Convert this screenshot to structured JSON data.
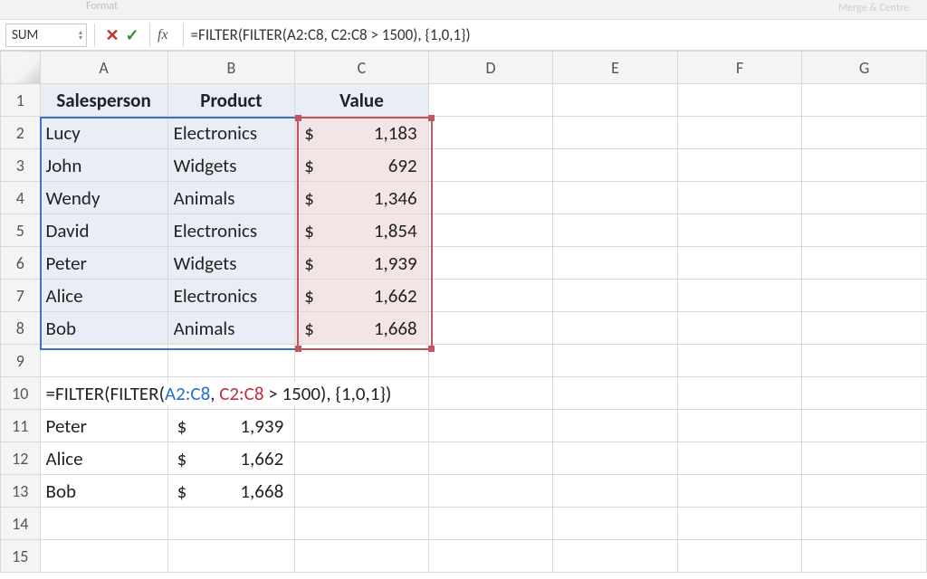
{
  "ribbon": {
    "format_hint": "Format",
    "faded_right": "Merge & Centre"
  },
  "formula_bar": {
    "name_box": "SUM",
    "cancel_glyph": "✕",
    "accept_glyph": "✓",
    "fx_label": "fx",
    "formula": "=FILTER(FILTER(A2:C8, C2:C8 > 1500), {1,0,1})"
  },
  "columns": [
    "A",
    "B",
    "C",
    "D",
    "E",
    "F",
    "G"
  ],
  "rows": [
    "1",
    "2",
    "3",
    "4",
    "5",
    "6",
    "7",
    "8",
    "9",
    "10",
    "11",
    "12",
    "13",
    "14",
    "15"
  ],
  "headers": {
    "salesperson": "Salesperson",
    "product": "Product",
    "value": "Value"
  },
  "data": [
    {
      "salesperson": "Lucy",
      "product": "Electronics",
      "value": "1,183"
    },
    {
      "salesperson": "John",
      "product": "Widgets",
      "value": "692"
    },
    {
      "salesperson": "Wendy",
      "product": "Animals",
      "value": "1,346"
    },
    {
      "salesperson": "David",
      "product": "Electronics",
      "value": "1,854"
    },
    {
      "salesperson": "Peter",
      "product": "Widgets",
      "value": "1,939"
    },
    {
      "salesperson": "Alice",
      "product": "Electronics",
      "value": "1,662"
    },
    {
      "salesperson": "Bob",
      "product": "Animals",
      "value": "1,668"
    }
  ],
  "currency_symbol": "$",
  "row10_formula": {
    "pre": "=FILTER(FILTER(",
    "r1": "A2:C8",
    "mid1": ", ",
    "r2": "C2:C8",
    "mid2": " > 1500), {1,0,1})"
  },
  "filtered": [
    {
      "name": "Peter",
      "value": "1,939"
    },
    {
      "name": "Alice",
      "value": "1,662"
    },
    {
      "name": "Bob",
      "value": "1,668"
    }
  ],
  "chart_data": {
    "type": "table",
    "columns": [
      "Salesperson",
      "Product",
      "Value"
    ],
    "rows": [
      [
        "Lucy",
        "Electronics",
        1183
      ],
      [
        "John",
        "Widgets",
        692
      ],
      [
        "Wendy",
        "Animals",
        1346
      ],
      [
        "David",
        "Electronics",
        1854
      ],
      [
        "Peter",
        "Widgets",
        1939
      ],
      [
        "Alice",
        "Electronics",
        1662
      ],
      [
        "Bob",
        "Animals",
        1668
      ]
    ],
    "formula": "=FILTER(FILTER(A2:C8, C2:C8 > 1500), {1,0,1})",
    "filtered_output_columns": [
      "Salesperson",
      "Value"
    ],
    "filtered_output": [
      [
        "Peter",
        1939
      ],
      [
        "Alice",
        1662
      ],
      [
        "Bob",
        1668
      ]
    ]
  }
}
